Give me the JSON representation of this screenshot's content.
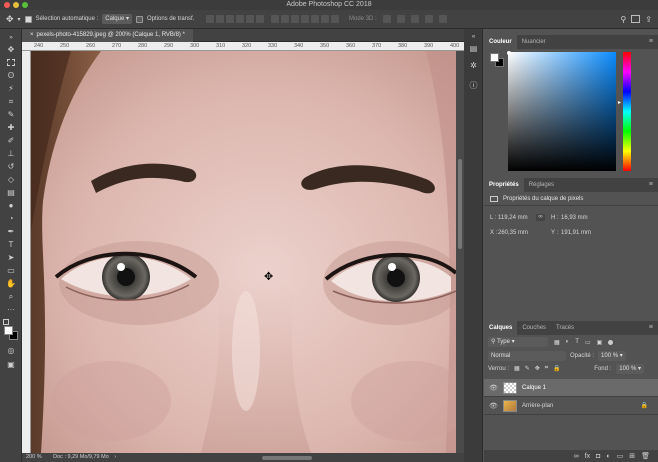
{
  "app_title": "Adobe Photoshop CC 2018",
  "window_controls": {
    "close_color": "#fc5b57",
    "minimize_color": "#e5bf3c",
    "maximize_color": "#57c038"
  },
  "options_bar": {
    "auto_select_label": "Sélection automatique :",
    "auto_select_value": "Calque",
    "transform_label": "Options de transf.",
    "mode_3d_label": "Mode 3D :"
  },
  "document_tab": {
    "title": "pexels-photo-415829.jpeg @ 200% (Calque 1, RVB/8) *"
  },
  "ruler": {
    "ticks": [
      "240",
      "250",
      "260",
      "270",
      "280",
      "290",
      "300",
      "310",
      "320",
      "330",
      "340",
      "350",
      "360",
      "370",
      "380",
      "390",
      "400"
    ]
  },
  "status": {
    "zoom": "200 %",
    "doc_info": "Doc : 9,29 Mo/9,79 Mo"
  },
  "color_panel": {
    "tabs": [
      "Couleur",
      "Nuancier"
    ],
    "foreground": "#ffffff",
    "background": "#000000"
  },
  "properties_panel": {
    "tabs": [
      "Propriétés",
      "Réglages"
    ],
    "heading": "Propriétés du calque de pixels",
    "l_label": "L :",
    "l_value": "119,24 mm",
    "h_label": "H :",
    "h_value": "16,93 mm",
    "x_label": "X :",
    "x_value": "260,35 mm",
    "y_label": "Y :",
    "y_value": "191,91 mm"
  },
  "layers_panel": {
    "tabs": [
      "Calques",
      "Couches",
      "Tracés"
    ],
    "filter": "Type",
    "blend_mode": "Normal",
    "opacity_label": "Opacité :",
    "opacity_value": "100 %",
    "lock_label": "Verrou :",
    "fill_label": "Fond :",
    "fill_value": "100 %",
    "layers": [
      {
        "name": "Calque 1",
        "selected": true
      },
      {
        "name": "Arrière-plan",
        "selected": false,
        "locked": true
      }
    ]
  },
  "icons": [
    "move-icon",
    "marquee-icon",
    "lasso-icon",
    "magic-wand-icon",
    "crop-icon",
    "eyedropper-icon",
    "healing-brush-icon",
    "brush-icon",
    "clone-stamp-icon",
    "history-brush-icon",
    "eraser-icon",
    "gradient-icon",
    "blur-icon",
    "dodge-icon",
    "pen-icon",
    "type-icon",
    "path-selection-icon",
    "shape-icon",
    "hand-icon",
    "zoom-icon"
  ]
}
